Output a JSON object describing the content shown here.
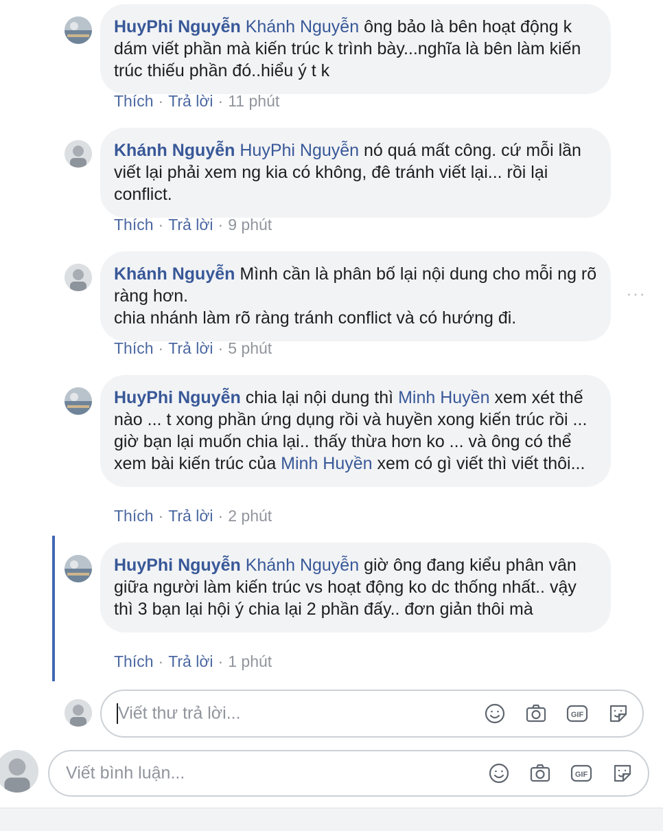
{
  "comments": [
    {
      "author": "HuyPhi Nguyễn",
      "mention": "Khánh Nguyễn",
      "text": "ông bảo là bên hoạt động k dám viết phần mà kiến trúc k trình bày...nghĩa là bên làm kiến trúc thiếu phần đó..hiểu ý t k",
      "like_label": "Thích",
      "reply_label": "Trả lời",
      "time": "11 phút"
    },
    {
      "author": "Khánh Nguyễn",
      "mention": "HuyPhi Nguyễn",
      "text": "nó quá mất công. cứ mỗi lần viết lại phải xem ng kia có không, đê tránh viết lại... rồi lại conflict.",
      "like_label": "Thích",
      "reply_label": "Trả lời",
      "time": "9 phút"
    },
    {
      "author": "Khánh Nguyễn",
      "line1": "Mình cần là phân bố lại nội dung cho mỗi ng rõ ràng hơn.",
      "line2": "chia nhánh làm rõ ràng tránh conflict và có hướng đi.",
      "like_label": "Thích",
      "reply_label": "Trả lời",
      "time": "5 phút"
    },
    {
      "author": "HuyPhi Nguyễn",
      "text_a": "chia lại nội dung thì",
      "mention_a": "Minh Huyền",
      "text_b": "xem xét thế nào ... t xong phần ứng dụng rồi và huyền xong kiến trúc rồi ... giờ bạn lại muốn chia lại.. thấy thừa hơn ko ... và ông có thể xem bài kiến trúc của",
      "mention_b": "Minh Huyền",
      "text_c": "xem có gì viết thì viết thôi...",
      "like_label": "Thích",
      "reply_label": "Trả lời",
      "time": "2 phút"
    },
    {
      "author": "HuyPhi Nguyễn",
      "mention": "Khánh Nguyễn",
      "text": "giờ ông đang kiểu phân vân giữa người làm kiến trúc vs hoạt động ko dc thống nhất.. vậy thì 3 bạn lại hội ý chia lại 2 phần đấy.. đơn giản thôi mà",
      "like_label": "Thích",
      "reply_label": "Trả lời",
      "time": "1 phút"
    }
  ],
  "more_icon": "···",
  "reply_composer": {
    "placeholder": "Viết thư trả lời...",
    "gif_label": "GIF"
  },
  "comment_composer": {
    "placeholder": "Viết bình luận...",
    "gif_label": "GIF"
  },
  "colors": {
    "link": "#385898",
    "bubble": "#f2f3f5",
    "thread_bar": "#4267b2",
    "meta": "#90949c"
  }
}
